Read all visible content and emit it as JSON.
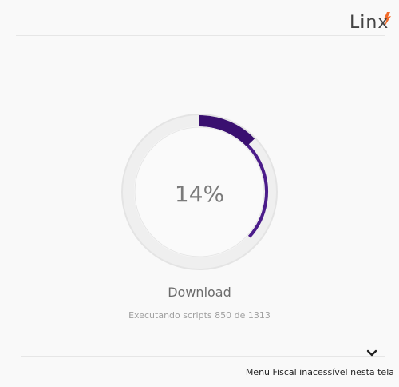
{
  "brand": {
    "name": "Linx",
    "accent_color": "#f26b2a",
    "text_color": "#444444"
  },
  "progress": {
    "percent_label": "14%",
    "value": 0.14,
    "track_color": "#ececec",
    "fill_color": "#4b1c8a",
    "fill_dark_color": "#3a1070"
  },
  "status": {
    "step": "Download",
    "detail": "Executando scripts 850 de 1313"
  },
  "footer": {
    "toggle_icon": "chevron-down-icon",
    "message": "Menu Fiscal inacessível nesta tela"
  }
}
